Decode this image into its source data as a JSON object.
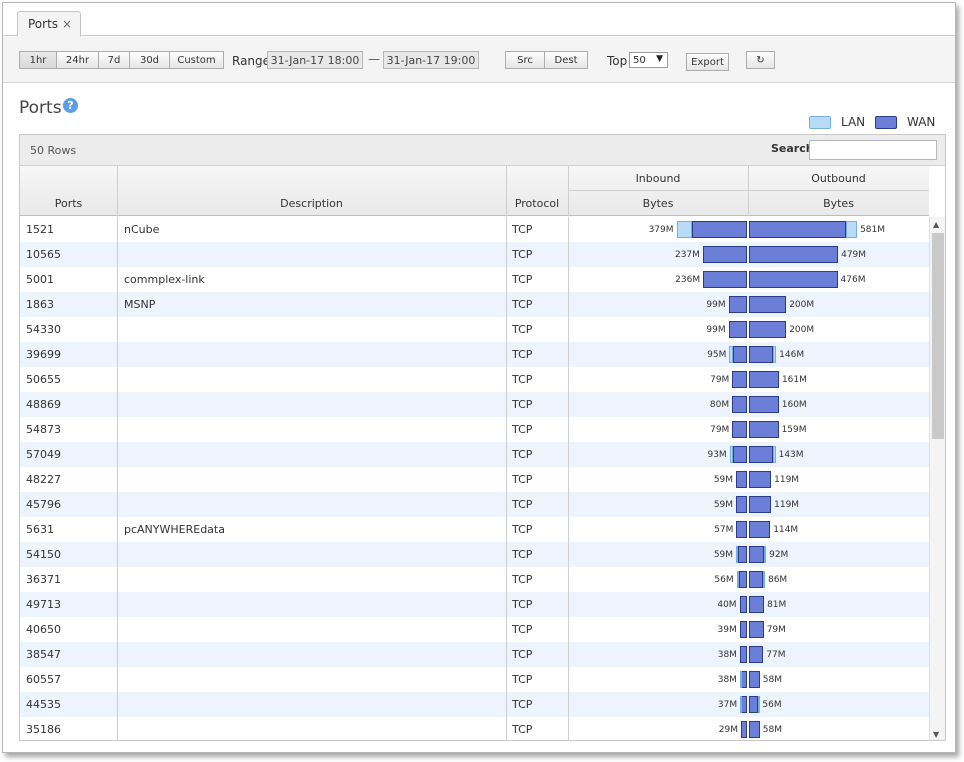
{
  "tab": {
    "label": "Ports",
    "close": "×"
  },
  "toolbar": {
    "time_buttons": [
      "1hr",
      "24hr",
      "7d",
      "30d",
      "Custom"
    ],
    "range_label": "Range",
    "range_start": "31-Jan-17 18:00",
    "range_sep": "—",
    "range_end": "31-Jan-17 19:00",
    "src_label": "Src",
    "dest_label": "Dest",
    "top_label": "Top",
    "top_value": "50",
    "export_label": "Export",
    "refresh_glyph": "↻"
  },
  "page": {
    "title": "Ports",
    "help": "?"
  },
  "legend": {
    "lan_label": "LAN",
    "wan_label": "WAN",
    "lan_color": "#b8dcf8",
    "wan_color": "#6b7fd9"
  },
  "grid": {
    "row_count": "50 Rows",
    "search_label": "Search",
    "group_inbound": "Inbound",
    "group_outbound": "Outbound",
    "col_ports": "Ports",
    "col_description": "Description",
    "col_protocol": "Protocol",
    "col_in_bytes": "Bytes",
    "col_out_bytes": "Bytes"
  },
  "rows": [
    {
      "port": "1521",
      "desc": "nCube",
      "proto": "TCP",
      "in": "379M",
      "out": "581M",
      "in_lan": 0.22,
      "in_wan": 0.78,
      "out_lan": 0.1,
      "out_wan": 0.9
    },
    {
      "port": "10565",
      "desc": "",
      "proto": "TCP",
      "in": "237M",
      "out": "479M",
      "in_lan": 0,
      "in_wan": 1,
      "out_lan": 0,
      "out_wan": 1
    },
    {
      "port": "5001",
      "desc": "commplex-link",
      "proto": "TCP",
      "in": "236M",
      "out": "476M",
      "in_lan": 0,
      "in_wan": 1,
      "out_lan": 0,
      "out_wan": 1
    },
    {
      "port": "1863",
      "desc": "MSNP",
      "proto": "TCP",
      "in": "99M",
      "out": "200M",
      "in_lan": 0,
      "in_wan": 1,
      "out_lan": 0,
      "out_wan": 1
    },
    {
      "port": "54330",
      "desc": "",
      "proto": "TCP",
      "in": "99M",
      "out": "200M",
      "in_lan": 0,
      "in_wan": 1,
      "out_lan": 0,
      "out_wan": 1
    },
    {
      "port": "39699",
      "desc": "",
      "proto": "TCP",
      "in": "95M",
      "out": "146M",
      "in_lan": 0.2,
      "in_wan": 0.8,
      "out_lan": 0.1,
      "out_wan": 0.9
    },
    {
      "port": "50655",
      "desc": "",
      "proto": "TCP",
      "in": "79M",
      "out": "161M",
      "in_lan": 0,
      "in_wan": 1,
      "out_lan": 0,
      "out_wan": 1
    },
    {
      "port": "48869",
      "desc": "",
      "proto": "TCP",
      "in": "80M",
      "out": "160M",
      "in_lan": 0,
      "in_wan": 1,
      "out_lan": 0,
      "out_wan": 1
    },
    {
      "port": "54873",
      "desc": "",
      "proto": "TCP",
      "in": "79M",
      "out": "159M",
      "in_lan": 0,
      "in_wan": 1,
      "out_lan": 0,
      "out_wan": 1
    },
    {
      "port": "57049",
      "desc": "",
      "proto": "TCP",
      "in": "93M",
      "out": "143M",
      "in_lan": 0.2,
      "in_wan": 0.8,
      "out_lan": 0.1,
      "out_wan": 0.9
    },
    {
      "port": "48227",
      "desc": "",
      "proto": "TCP",
      "in": "59M",
      "out": "119M",
      "in_lan": 0,
      "in_wan": 1,
      "out_lan": 0,
      "out_wan": 1
    },
    {
      "port": "45796",
      "desc": "",
      "proto": "TCP",
      "in": "59M",
      "out": "119M",
      "in_lan": 0,
      "in_wan": 1,
      "out_lan": 0,
      "out_wan": 1
    },
    {
      "port": "5631",
      "desc": "pcANYWHEREdata",
      "proto": "TCP",
      "in": "57M",
      "out": "114M",
      "in_lan": 0,
      "in_wan": 1,
      "out_lan": 0,
      "out_wan": 1
    },
    {
      "port": "54150",
      "desc": "",
      "proto": "TCP",
      "in": "59M",
      "out": "92M",
      "in_lan": 0.2,
      "in_wan": 0.8,
      "out_lan": 0.1,
      "out_wan": 0.9
    },
    {
      "port": "36371",
      "desc": "",
      "proto": "TCP",
      "in": "56M",
      "out": "86M",
      "in_lan": 0.2,
      "in_wan": 0.8,
      "out_lan": 0.15,
      "out_wan": 0.85
    },
    {
      "port": "49713",
      "desc": "",
      "proto": "TCP",
      "in": "40M",
      "out": "81M",
      "in_lan": 0,
      "in_wan": 1,
      "out_lan": 0,
      "out_wan": 1
    },
    {
      "port": "40650",
      "desc": "",
      "proto": "TCP",
      "in": "39M",
      "out": "79M",
      "in_lan": 0,
      "in_wan": 1,
      "out_lan": 0,
      "out_wan": 1
    },
    {
      "port": "38547",
      "desc": "",
      "proto": "TCP",
      "in": "38M",
      "out": "77M",
      "in_lan": 0,
      "in_wan": 1,
      "out_lan": 0,
      "out_wan": 1
    },
    {
      "port": "60557",
      "desc": "",
      "proto": "TCP",
      "in": "38M",
      "out": "58M",
      "in_lan": 0.2,
      "in_wan": 0.8,
      "out_lan": 0,
      "out_wan": 1
    },
    {
      "port": "44535",
      "desc": "",
      "proto": "TCP",
      "in": "37M",
      "out": "56M",
      "in_lan": 0.2,
      "in_wan": 0.8,
      "out_lan": 0.15,
      "out_wan": 0.85
    },
    {
      "port": "35186",
      "desc": "",
      "proto": "TCP",
      "in": "29M",
      "out": "58M",
      "in_lan": 0,
      "in_wan": 1,
      "out_lan": 0,
      "out_wan": 1
    }
  ]
}
